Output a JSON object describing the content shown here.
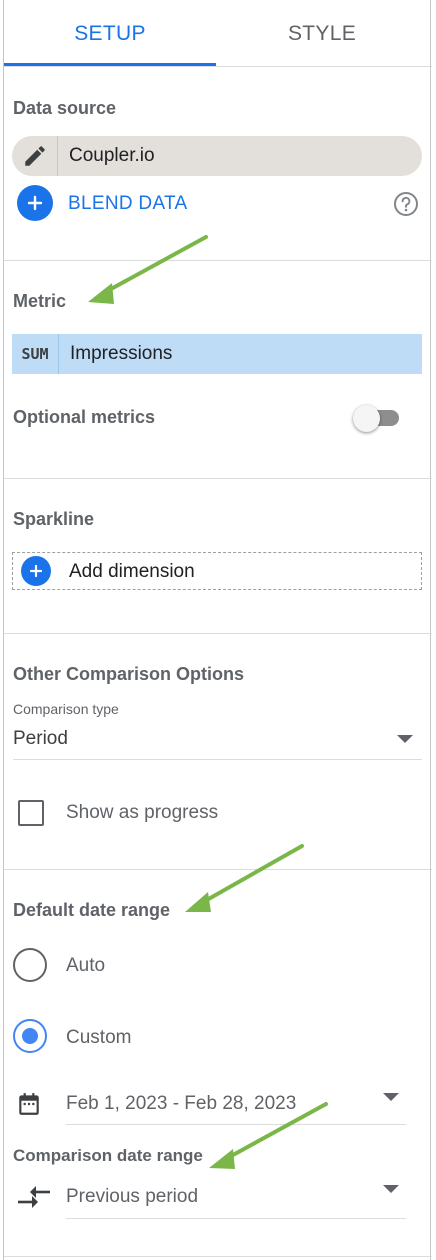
{
  "tabs": [
    {
      "label": "SETUP",
      "active": true
    },
    {
      "label": "STYLE",
      "active": false
    }
  ],
  "data_source": {
    "title": "Data source",
    "source_name": "Coupler.io",
    "blend_label": "BLEND DATA",
    "icons": [
      "pencil-icon",
      "plus-icon",
      "help-icon"
    ]
  },
  "metric": {
    "title": "Metric",
    "aggregation": "SUM",
    "field": "Impressions",
    "optional_label": "Optional metrics",
    "optional_enabled": false
  },
  "sparkline": {
    "title": "Sparkline",
    "add_label": "Add dimension"
  },
  "comparison": {
    "title": "Other Comparison Options",
    "type_label": "Comparison type",
    "type_value": "Period",
    "progress_label": "Show as progress",
    "progress_checked": false
  },
  "date_range": {
    "title": "Default date range",
    "options": [
      {
        "label": "Auto",
        "selected": false
      },
      {
        "label": "Custom",
        "selected": true
      }
    ],
    "custom_value": "Feb 1, 2023 - Feb 28, 2023",
    "comparison_title": "Comparison date range",
    "comparison_value": "Previous period"
  },
  "colors": {
    "accent": "#1a73e8",
    "metric_chip": "#bfdcf7",
    "source_chip": "#e3dfdb",
    "annotation_arrow": "#7ab648"
  }
}
